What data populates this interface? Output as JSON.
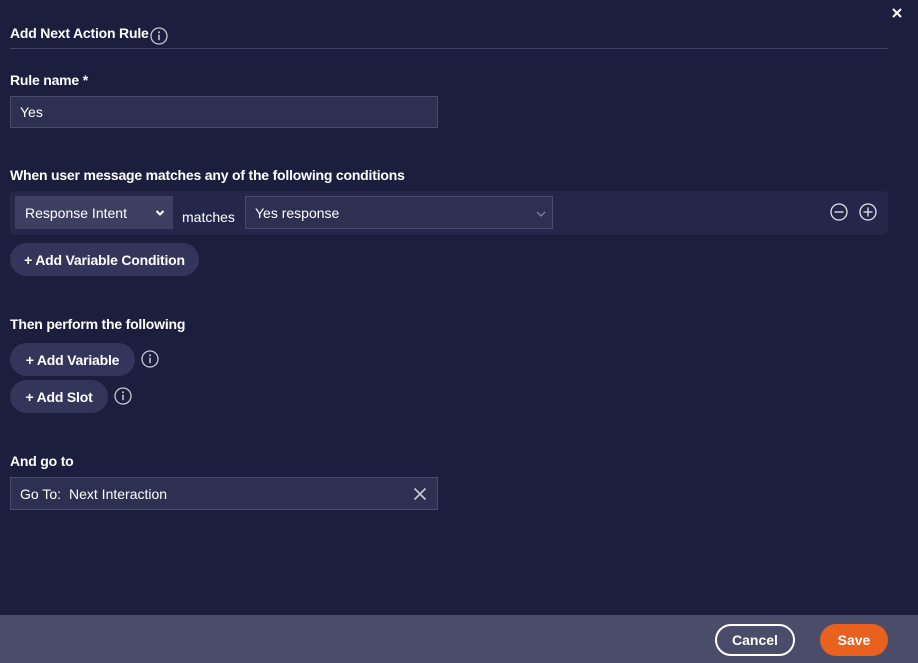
{
  "dialog": {
    "title": "Add Next Action Rule",
    "close_icon": "close-icon",
    "info_icon": "info-icon"
  },
  "rule_name": {
    "label": "Rule name *",
    "value": "Yes"
  },
  "conditions": {
    "label": "When user message matches any of the following conditions",
    "rows": [
      {
        "type_value": "Response Intent",
        "operator": "matches",
        "match_value": "Yes response"
      }
    ],
    "add_condition_label": "+ Add Variable Condition"
  },
  "actions": {
    "label": "Then perform the following",
    "add_variable_label": "+ Add Variable",
    "add_slot_label": "+ Add Slot"
  },
  "goto": {
    "label": "And go to",
    "prefix": "Go To:",
    "value": "Next Interaction"
  },
  "footer": {
    "cancel_label": "Cancel",
    "save_label": "Save"
  },
  "colors": {
    "background": "#1b1e3d",
    "accent": "#e8611f",
    "footer": "#4a4d6a"
  }
}
